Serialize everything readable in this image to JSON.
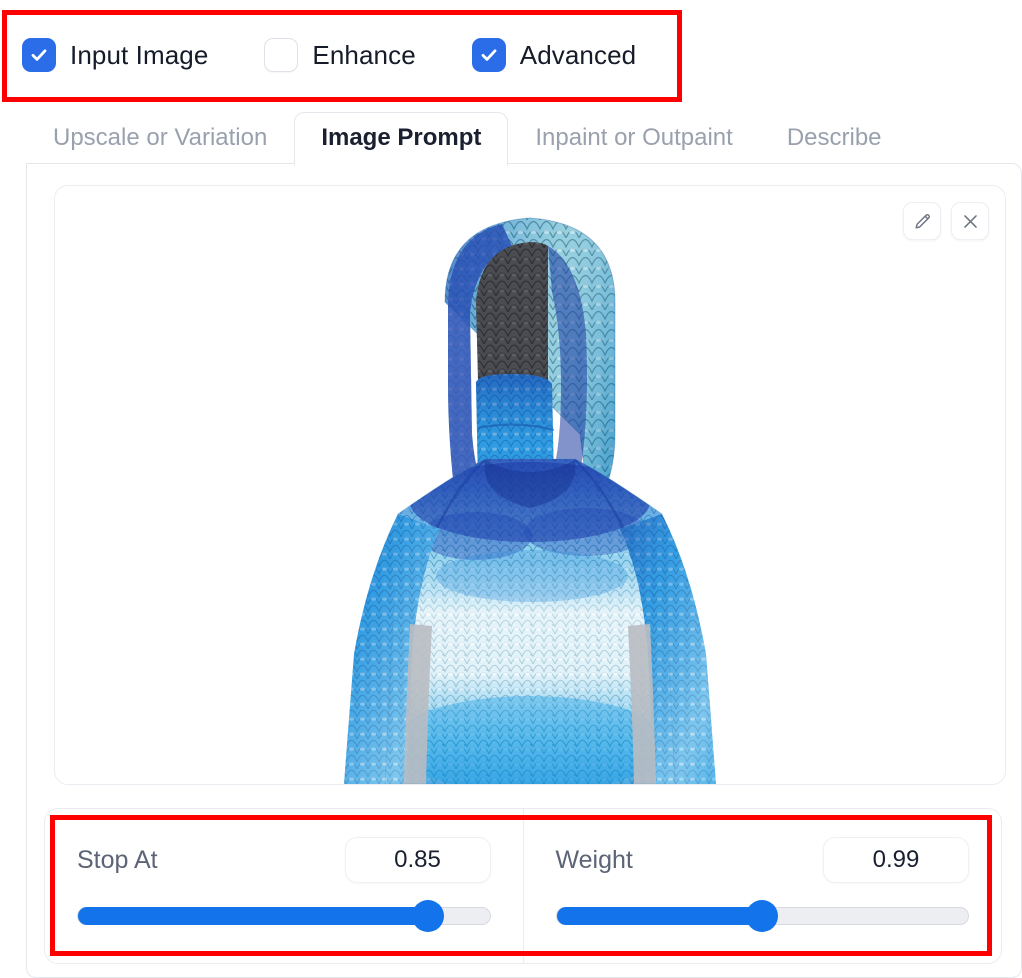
{
  "options": {
    "items": [
      {
        "label": "Input Image",
        "checked": true,
        "name": "input-image"
      },
      {
        "label": "Enhance",
        "checked": false,
        "name": "enhance"
      },
      {
        "label": "Advanced",
        "checked": true,
        "name": "advanced"
      }
    ]
  },
  "tabs": {
    "items": [
      {
        "label": "Upscale or Variation",
        "active": false
      },
      {
        "label": "Image Prompt",
        "active": true
      },
      {
        "label": "Inpaint or Outpaint",
        "active": false
      },
      {
        "label": "Describe",
        "active": false
      }
    ],
    "active_label": "Image Prompt"
  },
  "image_card": {
    "actions": [
      {
        "icon": "pencil-icon",
        "name": "edit-image-button"
      },
      {
        "icon": "close-icon",
        "name": "remove-image-button"
      }
    ],
    "alt": "Blue fish-scale pattern hooded long-sleeve performance shirt on mannequin"
  },
  "sliders": [
    {
      "label": "Stop At",
      "value": "0.85",
      "percent": 85,
      "name": "stop-at"
    },
    {
      "label": "Weight",
      "value": "0.99",
      "percent": 50,
      "name": "weight"
    }
  ],
  "colors": {
    "accent_blue": "#1273EB",
    "checkbox_blue": "#2B6CE8",
    "annotation_red": "#FF0000",
    "text_dark": "#1a2030",
    "text_muted": "#9aa1ae",
    "border_light": "#e4e7ec"
  }
}
